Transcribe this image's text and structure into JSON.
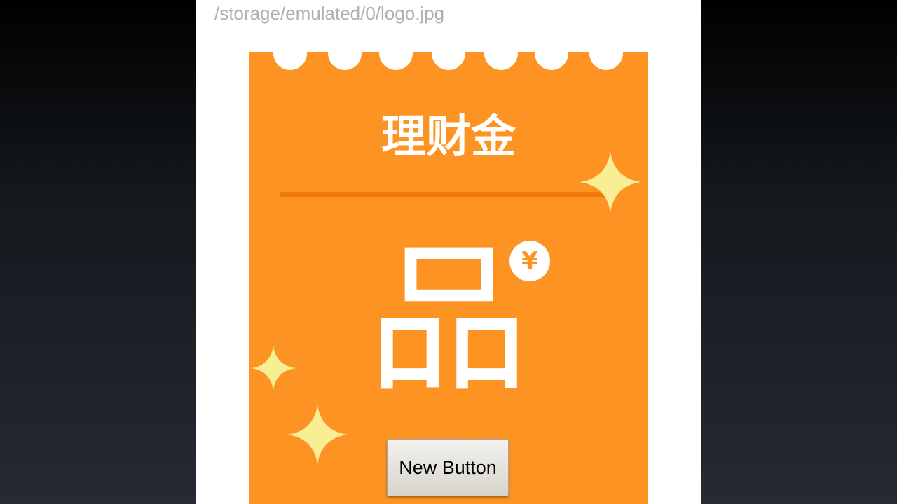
{
  "file_path": "/storage/emulated/0/logo.jpg",
  "image": {
    "title": "理财金",
    "glyph": "品",
    "coin_symbol": "¥",
    "colors": {
      "ticket": "#fc9322",
      "divider": "#f07a0c",
      "sparkle": "#f8ef94",
      "text": "#ffffff"
    }
  },
  "button": {
    "label": "New Button"
  }
}
